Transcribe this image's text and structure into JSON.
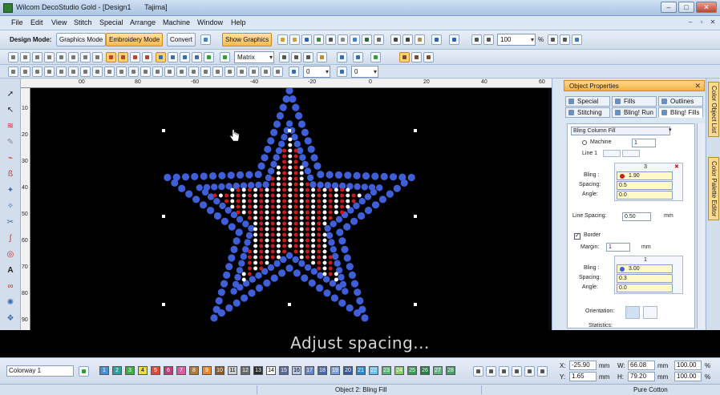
{
  "window": {
    "title": "Wilcom DecoStudio Gold - [Design1",
    "title_machine": "Tajima]",
    "minimize": "–",
    "maximize": "□",
    "close": "✕"
  },
  "menu": [
    "File",
    "Edit",
    "View",
    "Stitch",
    "Special",
    "Arrange",
    "Machine",
    "Window",
    "Help"
  ],
  "toolbar1": {
    "design_mode_label": "Design Mode:",
    "graphics_mode": "Graphics Mode",
    "embroidery_mode": "Embroidery Mode",
    "convert": "Convert",
    "show_graphics": "Show Graphics",
    "zoom_value": "100",
    "zoom_unit": "%"
  },
  "toolbar2": {
    "fill_type": "Matrix"
  },
  "toolbar3": {
    "rotate_value": "0",
    "slant_value": "0"
  },
  "rulers": {
    "horizontal": [
      "00",
      "80",
      "-60",
      "-40",
      "-20",
      "0",
      "20",
      "40",
      "60"
    ],
    "vertical": [
      "10",
      "20",
      "30",
      "40",
      "50",
      "60",
      "70",
      "80",
      "90"
    ]
  },
  "object_properties": {
    "title": "Object Properties",
    "tabs_row1": [
      "Special",
      "Fills",
      "Outlines"
    ],
    "tabs_row2": [
      "Stitching",
      "Bling! Run",
      "Bling! Fills"
    ],
    "fill_type": "Bling Column Fill",
    "machine_label": "Machine",
    "machine_value": "1",
    "line_label": "Line 1",
    "col_number": "3",
    "bling_label": "Bling :",
    "bling_value": "1.90",
    "spacing_label": "Spacing:",
    "spacing_value": "0.5",
    "angle_label": "Angle:",
    "angle_value": "0.0",
    "line_spacing_label": "Line Spacing:",
    "line_spacing_value": "0.50",
    "line_spacing_unit": "mm",
    "border_label": "Border",
    "margin_label": "Margin:",
    "margin_value": "1",
    "margin_unit": "mm",
    "border_col": "1",
    "border_bling_value": "3.00",
    "border_spacing_value": "0.3",
    "border_angle_value": "0.0",
    "orientation_label": "Orientation:",
    "statistics_label": "Statistics:"
  },
  "side_tabs": [
    "Color Object List",
    "Color Palette Editor"
  ],
  "caption": "Adjust spacing...",
  "colorbar": {
    "colorway": "Colorway 1",
    "chips": [
      {
        "n": "1",
        "color": "#4a8fd4"
      },
      {
        "n": "2",
        "color": "#2aa198"
      },
      {
        "n": "3",
        "color": "#3fae49"
      },
      {
        "n": "4",
        "color": "#e6e03a"
      },
      {
        "n": "5",
        "color": "#e04a3a"
      },
      {
        "n": "6",
        "color": "#c23b7c"
      },
      {
        "n": "7",
        "color": "#d95fa0"
      },
      {
        "n": "8",
        "color": "#b07a3a"
      },
      {
        "n": "9",
        "color": "#e8882a"
      },
      {
        "n": "10",
        "color": "#8a5a2a"
      },
      {
        "n": "11",
        "color": "#cfcfcf"
      },
      {
        "n": "12",
        "color": "#6a6a6a"
      },
      {
        "n": "13",
        "color": "#2b2b2b"
      },
      {
        "n": "14",
        "color": "#ffffff"
      },
      {
        "n": "15",
        "color": "#5a6a9a"
      },
      {
        "n": "16",
        "color": "#b6c8e6"
      },
      {
        "n": "17",
        "color": "#6a86c0"
      },
      {
        "n": "18",
        "color": "#4a6aa8"
      },
      {
        "n": "19",
        "color": "#7aa0d8"
      },
      {
        "n": "20",
        "color": "#3a5a98"
      },
      {
        "n": "21",
        "color": "#2a8ac8"
      },
      {
        "n": "22",
        "color": "#6ac0e8"
      },
      {
        "n": "23",
        "color": "#5ab07a"
      },
      {
        "n": "24",
        "color": "#8acc6a"
      },
      {
        "n": "25",
        "color": "#3a9a5a"
      },
      {
        "n": "26",
        "color": "#2a7a4a"
      },
      {
        "n": "27",
        "color": "#6ab08a"
      },
      {
        "n": "28",
        "color": "#4a9a6a"
      }
    ],
    "x_label": "X:",
    "x_value": "-25.90",
    "x_unit": "mm",
    "y_label": "Y:",
    "y_value": "1.65",
    "y_unit": "mm",
    "w_label": "W:",
    "w_value": "66.08",
    "w_unit": "mm",
    "h_label": "H:",
    "h_value": "79.20",
    "h_unit": "mm",
    "sx_value": "100.00",
    "sx_unit": "%",
    "sy_value": "100.00",
    "sy_unit": "%"
  },
  "status": {
    "object": "Object 2: Bling Fill",
    "fabric": "Pure Cotton"
  },
  "colors": {
    "canvas": "#000000",
    "outline_rhinestone": "#3f5fd8",
    "fill_red": "#c91c1c",
    "fill_white": "#ffffff",
    "accent": "#f4b245"
  }
}
